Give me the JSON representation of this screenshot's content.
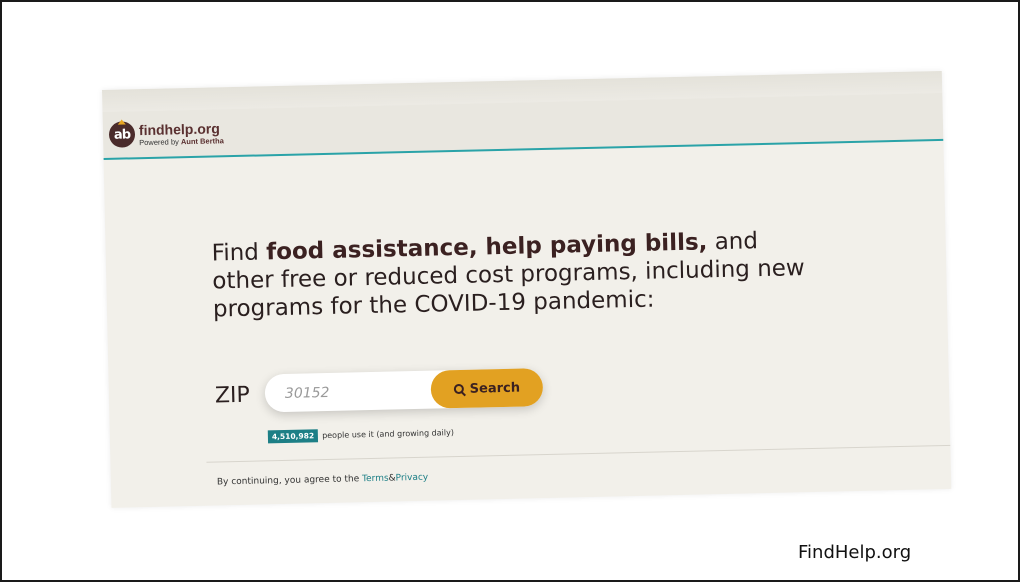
{
  "header": {
    "brand_name": "findhelp.org",
    "brand_sub_prefix": "Powered by",
    "brand_sub_name": "Aunt Bertha",
    "logo_glyph": "ab"
  },
  "hero": {
    "headline_part1": "Find ",
    "headline_bold": "food assistance, help paying bills,",
    "headline_part2": " and other free or reduced cost programs, including new programs for the COVID-19 pandemic:"
  },
  "search": {
    "zip_label": "ZIP",
    "zip_placeholder": "30152",
    "button_label": "Search",
    "button_icon": "search-icon"
  },
  "usage": {
    "count": "4,510,982",
    "text": "people use it (and growing daily)"
  },
  "legal": {
    "prefix": "By continuing, you agree to the",
    "terms_link": "Terms",
    "ampersand": "&",
    "privacy_link": "Privacy"
  },
  "caption": "FindHelp.org",
  "colors": {
    "accent_teal": "#2aa3a8",
    "button_gold": "#e2a122",
    "brand_brown": "#4a2b2b"
  }
}
